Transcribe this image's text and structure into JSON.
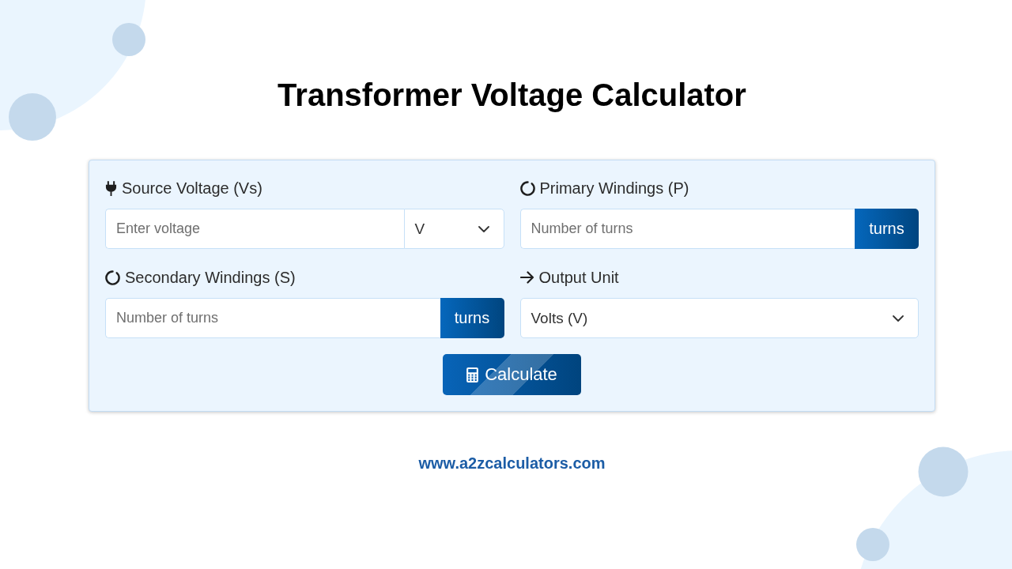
{
  "title": "Transformer Voltage Calculator",
  "fields": [
    {
      "kind": "input_select",
      "label": "Source Voltage (Vs)",
      "placeholder": "Enter voltage",
      "unit": "V"
    },
    {
      "kind": "input_addon",
      "label": "Primary Windings (P)",
      "placeholder": "Number of turns",
      "addon": "turns"
    },
    {
      "kind": "input_addon",
      "label": "Secondary Windings (S)",
      "placeholder": "Number of turns",
      "addon": "turns"
    },
    {
      "kind": "select",
      "label": "Output Unit",
      "value": "Volts (V)"
    }
  ],
  "button": {
    "label": "Calculate"
  },
  "footer": "www.a2zcalculators.com"
}
